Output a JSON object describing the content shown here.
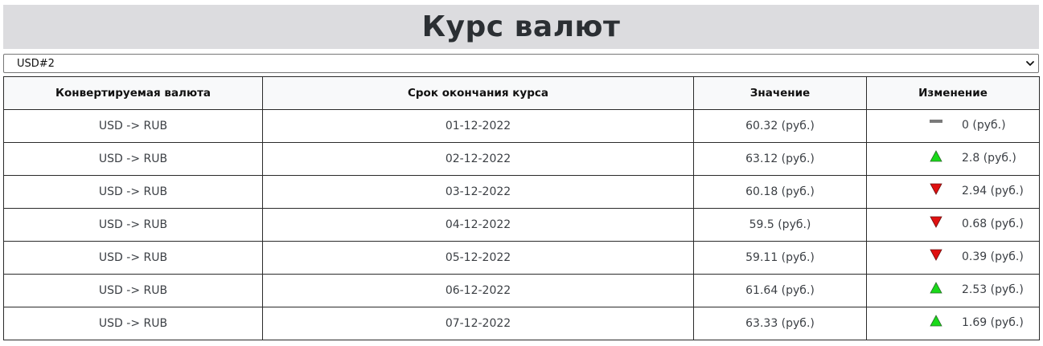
{
  "page": {
    "title": "Курс валют"
  },
  "selector": {
    "value": "USD#2"
  },
  "table": {
    "headers": [
      "Конвертируемая валюта",
      "Срок окончания курса",
      "Значение",
      "Изменение"
    ],
    "rows": [
      {
        "pair": "USD -> RUB",
        "date": "01-12-2022",
        "value": "60.32 (руб.)",
        "direction": "same",
        "change": "0 (руб.)"
      },
      {
        "pair": "USD -> RUB",
        "date": "02-12-2022",
        "value": "63.12 (руб.)",
        "direction": "up",
        "change": "2.8 (руб.)"
      },
      {
        "pair": "USD -> RUB",
        "date": "03-12-2022",
        "value": "60.18 (руб.)",
        "direction": "down",
        "change": "2.94 (руб.)"
      },
      {
        "pair": "USD -> RUB",
        "date": "04-12-2022",
        "value": "59.5 (руб.)",
        "direction": "down",
        "change": "0.68 (руб.)"
      },
      {
        "pair": "USD -> RUB",
        "date": "05-12-2022",
        "value": "59.11 (руб.)",
        "direction": "down",
        "change": "0.39 (руб.)"
      },
      {
        "pair": "USD -> RUB",
        "date": "06-12-2022",
        "value": "61.64 (руб.)",
        "direction": "up",
        "change": "2.53 (руб.)"
      },
      {
        "pair": "USD -> RUB",
        "date": "07-12-2022",
        "value": "63.33 (руб.)",
        "direction": "up",
        "change": "1.69 (руб.)"
      }
    ]
  },
  "icons": {
    "up": "triangle-up-icon",
    "down": "triangle-down-icon",
    "same": "dash-icon"
  },
  "colors": {
    "up": "#19d919",
    "down": "#e01010",
    "same": "#7a7a7a",
    "header_bg": "#dcdcdf"
  }
}
